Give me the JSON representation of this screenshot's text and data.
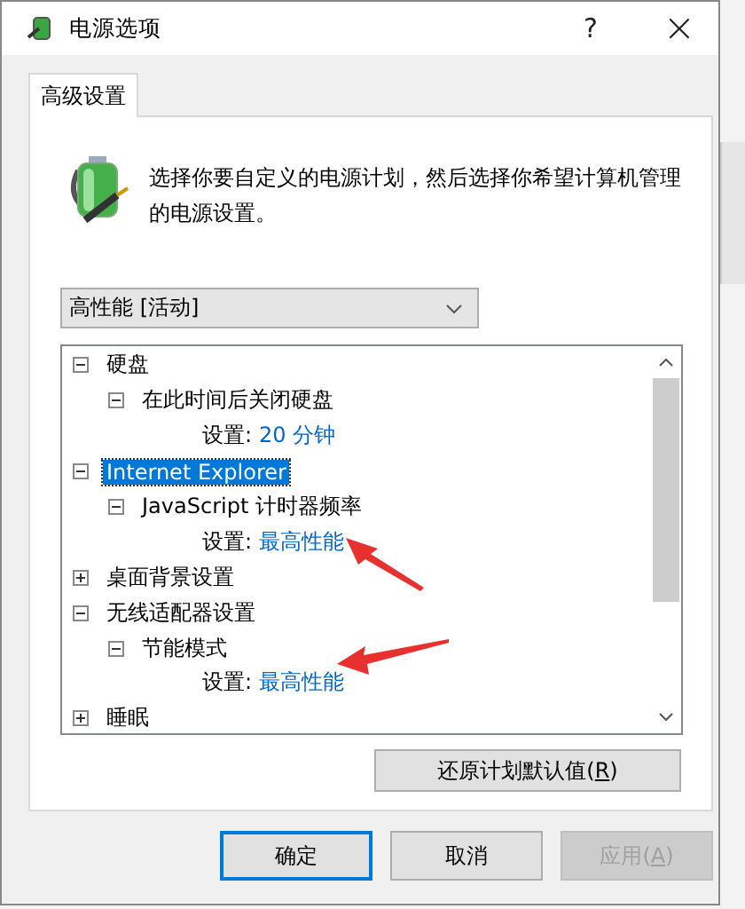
{
  "window": {
    "title": "电源选项",
    "help": "?",
    "close": "×"
  },
  "tabs": [
    {
      "label": "高级设置",
      "selected": true
    }
  ],
  "description": "选择你要自定义的电源计划，然后选择你希望计算机管理的电源设置。",
  "plan_dropdown": {
    "value": "高性能 [活动]"
  },
  "tree": [
    {
      "label": "硬盘",
      "expanded": true,
      "selected": false,
      "children": [
        {
          "label": "在此时间后关闭硬盘",
          "expanded": true,
          "selected": false,
          "children": [
            {
              "kind": "setting",
              "label": "设置:",
              "value": "20 分钟"
            }
          ]
        }
      ]
    },
    {
      "label": "Internet Explorer",
      "expanded": true,
      "selected": true,
      "children": [
        {
          "label": "JavaScript 计时器频率",
          "expanded": true,
          "selected": false,
          "children": [
            {
              "kind": "setting",
              "label": "设置:",
              "value": "最高性能"
            }
          ]
        }
      ]
    },
    {
      "label": "桌面背景设置",
      "expanded": false,
      "selected": false
    },
    {
      "label": "无线适配器设置",
      "expanded": true,
      "selected": false,
      "children": [
        {
          "label": "节能模式",
          "expanded": true,
          "selected": false,
          "children": [
            {
              "kind": "setting",
              "label": "设置:",
              "value": "最高性能"
            }
          ]
        }
      ]
    },
    {
      "label": "睡眠",
      "expanded": false,
      "selected": false
    }
  ],
  "restore_button": "还原计划默认值(R)",
  "buttons": [
    {
      "label": "确定",
      "default": true,
      "disabled": false
    },
    {
      "label": "取消",
      "default": false,
      "disabled": false
    },
    {
      "label": "应用(A)",
      "default": false,
      "disabled": true
    }
  ]
}
